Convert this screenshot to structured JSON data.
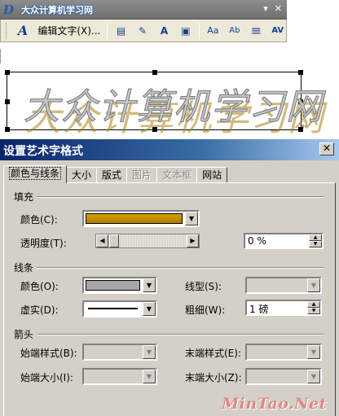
{
  "toolbar": {
    "logo_text": "大众计算机学习网",
    "edit_text_label": "编辑文字(X)...",
    "menu_glyph": "▾",
    "close_glyph": "✕",
    "icons": [
      "wordart-insert-icon",
      "wordart-gallery-icon",
      "format-wordart-icon",
      "wordart-shape-icon",
      "text-wrapping-icon",
      "same-letter-heights-icon",
      "vertical-text-icon",
      "alignment-icon",
      "character-spacing-icon"
    ],
    "glyphs": {
      "insert": "A",
      "gallery": "▤",
      "format": "✎",
      "shape": "A",
      "wrap": "▣",
      "same_height": "Aa",
      "vertical": "Ab",
      "align": "≡",
      "spacing": "AV"
    }
  },
  "wordart": {
    "text": "大众计算机学习网",
    "para_mark": "↵"
  },
  "dialog": {
    "title": "设置艺术字格式",
    "close": "✕",
    "tabs": [
      {
        "label": "颜色与线条",
        "active": true,
        "disabled": false
      },
      {
        "label": "大小",
        "active": false,
        "disabled": false
      },
      {
        "label": "版式",
        "active": false,
        "disabled": false
      },
      {
        "label": "图片",
        "active": false,
        "disabled": true
      },
      {
        "label": "文本框",
        "active": false,
        "disabled": true
      },
      {
        "label": "网站",
        "active": false,
        "disabled": false
      }
    ],
    "fill": {
      "section": "填充",
      "color_label": "颜色(C):",
      "color_value": "#d6a000",
      "transparency_label": "透明度(T):",
      "transparency_value": "0 %"
    },
    "line": {
      "section": "线条",
      "color_label": "颜色(O):",
      "color_value": "#a6a6a6",
      "style_label": "线型(S):",
      "dash_label": "虚实(D):",
      "weight_label": "粗细(W):",
      "weight_value": "1 磅"
    },
    "arrows": {
      "section": "箭头",
      "begin_style_label": "始端样式(B):",
      "end_style_label": "末端样式(E):",
      "begin_size_label": "始端大小(I):",
      "end_size_label": "末端大小(Z):"
    },
    "arrow_glyphs": {
      "down": "▼",
      "left": "◀",
      "right": "▶",
      "up": "▲"
    }
  },
  "watermark": "MinTao.Net"
}
